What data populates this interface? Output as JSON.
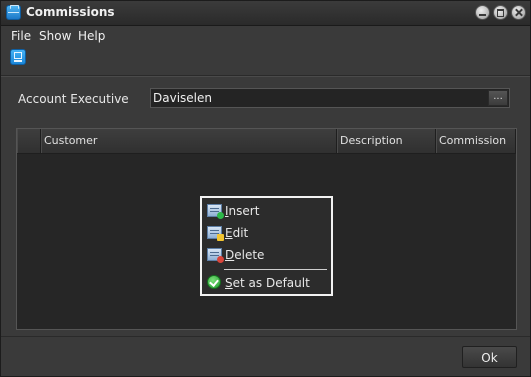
{
  "window": {
    "title": "Commissions",
    "icon": "briefcase-icon"
  },
  "menu": {
    "file": "File",
    "show": "Show",
    "help": "Help"
  },
  "toolbar": {
    "icon": "report-icon"
  },
  "account_executive": {
    "label": "Account Executive",
    "value": "Daviselen",
    "browse_label": "..."
  },
  "grid": {
    "columns": [
      "",
      "Customer",
      "Description",
      "Commission"
    ],
    "rows": []
  },
  "context_menu": {
    "insert": {
      "accel": "I",
      "rest": "nsert"
    },
    "edit": {
      "accel": "E",
      "rest": "dit"
    },
    "delete": {
      "accel": "D",
      "rest": "elete"
    },
    "set_default": {
      "accel": "S",
      "rest": "et as Default"
    }
  },
  "footer": {
    "ok_label": "Ok"
  }
}
